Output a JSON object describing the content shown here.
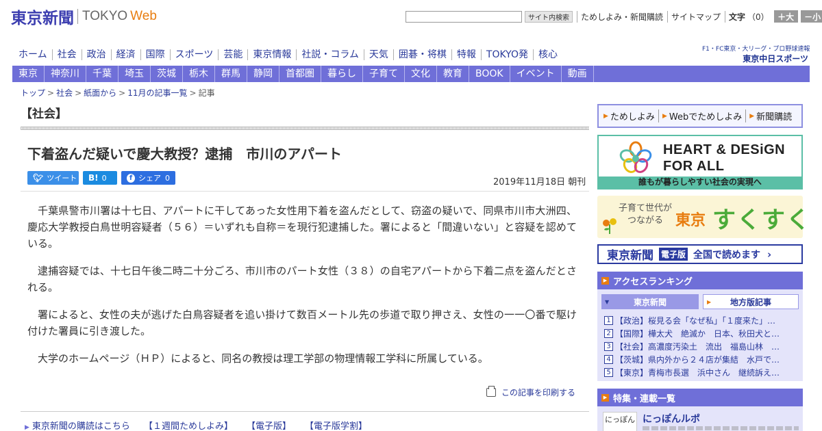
{
  "header": {
    "logo_jp": "東京新聞",
    "logo_tokyo": "TOKYO",
    "logo_web": "Web",
    "search": {
      "placeholder": "",
      "button_label": "サイト内検索"
    },
    "util_links": [
      "ためしよみ・新聞購読",
      "サイトマップ"
    ],
    "font_size_label": "文字",
    "font_size_value": "（0）",
    "font_bigger": "＋大",
    "font_smaller": "－小"
  },
  "nav_main": [
    "ホーム",
    "社会",
    "政治",
    "経済",
    "国際",
    "スポーツ",
    "芸能",
    "東京情報",
    "社説・コラム",
    "天気",
    "囲碁・将棋",
    "特報",
    "TOKYO発",
    "核心"
  ],
  "chunichi_sports": {
    "sub": "F1・FC東京・大リーグ・プロ野球速報",
    "name": "東京中日スポーツ"
  },
  "nav_region": [
    "東京",
    "神奈川",
    "千葉",
    "埼玉",
    "茨城",
    "栃木",
    "群馬",
    "静岡",
    "首都圏",
    "暮らし",
    "子育て",
    "文化",
    "教育",
    "BOOK",
    "イベント",
    "動画"
  ],
  "breadcrumb": [
    "トップ",
    "社会",
    "紙面から",
    "11月の記事一覧",
    "記事"
  ],
  "article": {
    "section": "【社会】",
    "headline": "下着盗んだ疑いで慶大教授？逮捕　市川のアパート",
    "share": {
      "tweet": "ツイート",
      "hatena_icon": "B!",
      "hatena_count": "0",
      "facebook": "シェア",
      "facebook_count": "0"
    },
    "dateline": "2019年11月18日 朝刊",
    "paragraphs": [
      "千葉県警市川署は十七日、アパートに干してあった女性用下着を盗んだとして、窃盗の疑いで、同県市川市大洲四、慶応大学教授白鳥世明容疑者（５６）＝いずれも自称＝を現行犯逮捕した。署によると「間違いない」と容疑を認めている。",
      "逮捕容疑では、十七日午後二時二十分ごろ、市川市のパート女性（３８）の自宅アパートから下着二点を盗んだとされる。",
      "署によると、女性の夫が逃げた白鳥容疑者を追い掛けて数百メートル先の歩道で取り押さえ、女性の一一〇番で駆け付けた署員に引き渡した。",
      "大学のホームページ（ＨＰ）によると、同名の教授は理工学部の物理情報工学科に所属している。"
    ],
    "print_label": "この記事を印刷する"
  },
  "footer_links": [
    "東京新聞の購読はこちら",
    "【１週間ためしよみ】",
    "【電子版】",
    "【電子版学割】"
  ],
  "sidebar": {
    "promo_links": [
      "ためしよみ",
      "Webでためしよみ",
      "新聞購読"
    ],
    "heart_design": {
      "title_line1": "HEART & DESiGN",
      "title_line2": "FOR ALL",
      "tagline": "誰もが暮らしやすい社会の実現へ"
    },
    "sukusuku": {
      "small_line1": "子育て世代が",
      "small_line2": "つながる",
      "tokyo": "東京",
      "big": "すくすく"
    },
    "denshiban": {
      "name": "東京新聞",
      "tag": "電子版",
      "text": "全国で読めます",
      "arrow": "›"
    },
    "ranking": {
      "title": "アクセスランキング",
      "tabs": [
        "東京新聞",
        "地方版記事"
      ],
      "items": [
        "【政治】桜見る会「なぜ私」「１度来た」…",
        "【国際】樺太犬　絶滅か　日本、秋田犬と…",
        "【社会】高濃度汚染土　流出　福島山林　…",
        "【茨城】県内外から２４店が集結　水戸で…",
        "【東京】青梅市長選　浜中さん　継続訴え…"
      ]
    },
    "features": {
      "title": "特集・連載一覧",
      "item_thumb": "にっぽん",
      "item_title": "にっぽんルポ"
    }
  },
  "colors": {
    "brand_blue": "#3c3eb0",
    "nav_purple": "#6f6fd8",
    "accent_orange": "#e87d10",
    "hd_green": "#5bbfa6",
    "share_blue": "#3b8fe8"
  }
}
